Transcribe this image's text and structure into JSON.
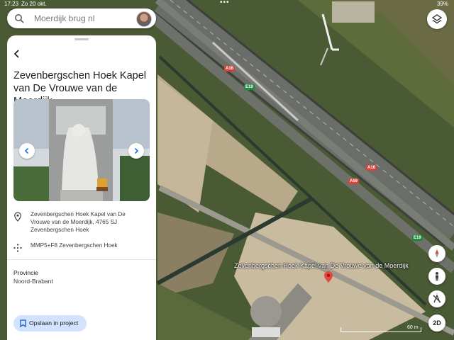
{
  "status_bar": {
    "time": "17:23",
    "date": "Zo 20 okt.",
    "battery": "39%"
  },
  "search": {
    "query": "Moerdijk brug nl"
  },
  "place": {
    "title": "Zevenbergschen Hoek Kapel van De Vrouwe van de Moerdijk",
    "address_line1": "Zevenbergschen Hoek Kapel van De",
    "address_line2": "Vrouwe van de Moerdijk, 4765 SJ",
    "address_line3": "Zevenbergschen Hoek",
    "plus_code": "MMP5+F8 Zevenbergschen Hoek",
    "province_label": "Provincie",
    "province_value": "Noord-Brabant",
    "save_label": "Opslaan in project"
  },
  "map": {
    "place_label": "Zevenbergschen Hoek Kapel van De Vrouwe van de Moerdijk",
    "roads": {
      "a16": "A16",
      "e19": "E19",
      "a59": "A59"
    },
    "scale": "60 m",
    "mode_button": "2D"
  },
  "colors": {
    "pin": "#e8453c",
    "save_bg": "#d3e3fd",
    "road_a": "#d9443a",
    "road_e": "#1e8a3e"
  },
  "icons": [
    "search-icon",
    "avatar",
    "layers-icon",
    "back-arrow-icon",
    "chevron-left-icon",
    "chevron-right-icon",
    "location-pin-icon",
    "plus-code-icon",
    "bookmark-icon",
    "compass-icon",
    "pegman-icon",
    "no-tilt-icon",
    "map-pin-icon"
  ]
}
